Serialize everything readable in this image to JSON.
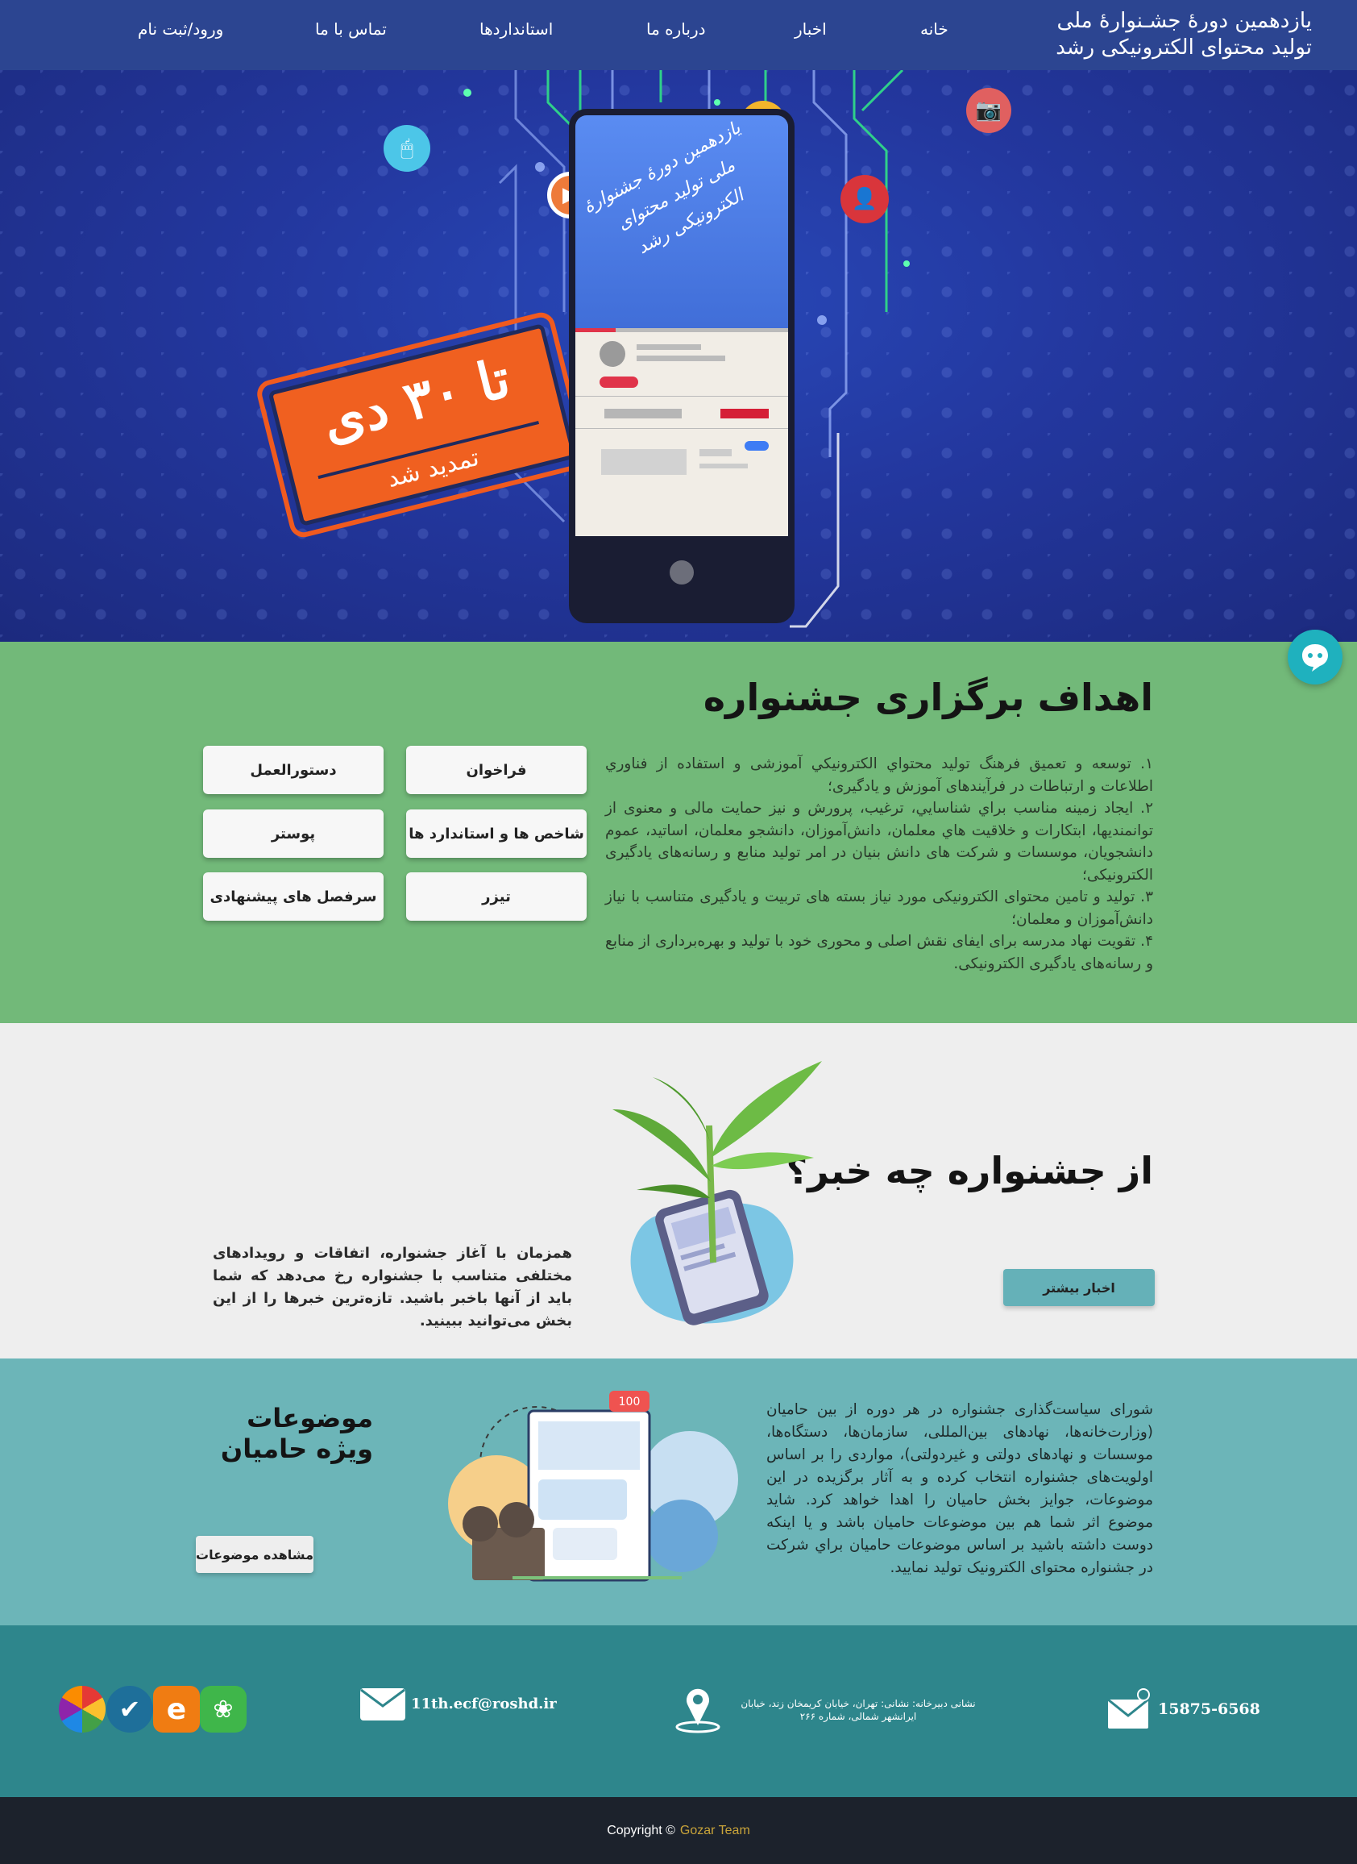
{
  "nav": {
    "brand_line1": "یازدهمین دورهٔ جشـنوارهٔ ملی",
    "brand_line2": "تولید محتوای الکترونیکی رشد",
    "items": [
      "خانه",
      "اخبار",
      "درباره ما",
      "استانداردها",
      "تماس با ما",
      "ورود/ثبت نام"
    ]
  },
  "hero": {
    "stamp_main": "تا ۳۰ دی",
    "stamp_sub": "تمدید شد",
    "phone_calligraphy": "یازدهمین دورهٔ جشنوارهٔ ملی تولید محتوای الکترونیکی رشد"
  },
  "goals": {
    "title": "اهداف برگزاری جشنواره",
    "paragraphs": [
      "۱. توسعه و تعمیق فرهنگ تولید محتواي الکترونيکي آموزشی و استفاده از فناوري اطلاعات و ارتباطات در فرآیندهای آموزش و یادگیری؛",
      "۲. ایجاد زمینه مناسب براي شناسايي، ترغیب، پرورش و نیز حمایت مالی و معنوی از توانمنديها، ابتکارات و خلاقیت هاي معلمان، دانش‌آموزان، دانشجو معلمان، اساتید، عموم دانشجویان، موسسات و شرکت های دانش بنیان در امر تولید منابع و رسانه‌های یادگیری الکترونیکی؛",
      "۳. تولید و تامین محتوای الکترونیکی مورد نیاز بسته های تربیت و یادگیری متناسب با نیاز دانش‌آموزان و معلمان؛",
      "۴. تقویت نهاد مدرسه برای ایفای نقش اصلی و محوری خود با تولید و بهره‌برداری از منابع و رسانه‌های یادگیری الکترونیکی."
    ],
    "buttons": [
      "فراخوان",
      "دستورالعمل",
      "شاخص ها و استاندارد ها",
      "پوستر",
      "تیزر",
      "سرفصل های پیشنهادی"
    ]
  },
  "news": {
    "title": "از جشنواره چه خبر؟",
    "button": "اخبار بیشتر",
    "text": "همزمان با آغاز جشنواره، اتفاقات و رویدادهای مختلفی متناسب با جشنواره رخ می‌دهد که شما باید از آنها باخبر باشید. تازه‌ترین خبرها را از این بخش می‌توانید ببینید."
  },
  "sponsor": {
    "title": "موضوعات ویژه حامیان",
    "button": "مشاهده موضوعات",
    "text": "شورای سیاست‌گذاری جشنواره در هر دوره از بین حامیان (وزارت‌خانه‌ها، نهادهای بین‌المللی، سازمان‌ها، دستگاه‌ها، موسسات و نهادهای دولتی و غیردولتی)، مواردی را بر اساس اولویت‌های جشنواره انتخاب کرده و به آثار برگزیده در این موضوعات، جوایز بخش حامیان را اهدا خواهد کرد. شاید موضوع اثر شما هم بین موضوعات حامیان باشد و یا اینکه دوست داشته باشید بر اساس موضوعات حامیان براي شرکت در جشنواره محتوای الکترونیک تولید نمایید.",
    "badge": "100"
  },
  "contact": {
    "phone": "15875-6568",
    "address": "نشانی دبیرخانه: نشانی: تهران، خیابان کریمخان زند، خیابان ایرانشهر شمالی، شماره ۲۶۶",
    "email": "11th.ecf@roshd.ir"
  },
  "footer": {
    "copyright": "Copyright ©",
    "team": "Gozar Team"
  },
  "colors": {
    "nav": "#2c4591",
    "goals": "#72b979",
    "news": "#eeeeee",
    "sponsor": "#6cb5b8",
    "contact": "#2e868c",
    "footer": "#1c222c",
    "accent_orange": "#f06020"
  }
}
